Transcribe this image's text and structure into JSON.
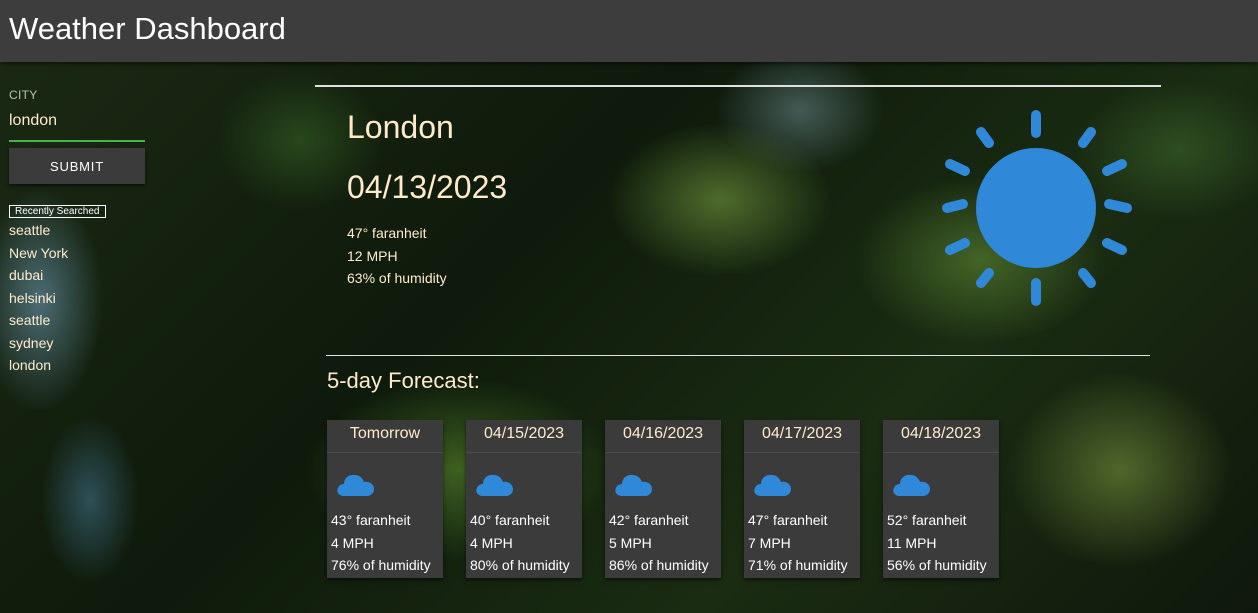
{
  "header": {
    "title": "Weather Dashboard"
  },
  "sidebar": {
    "city_label": "CITY",
    "city_value": "london",
    "submit_label": "SUBMIT",
    "recent_title": "Recently Searched",
    "recent": [
      "seattle",
      "New York",
      "dubai",
      "helsinki",
      "seattle",
      "sydney",
      "london"
    ]
  },
  "current": {
    "city": "London",
    "date": "04/13/2023",
    "temp": "47° faranheit",
    "wind": "12 MPH",
    "humidity": "63% of humidity",
    "icon": "sun-icon"
  },
  "forecast": {
    "title": "5-day Forecast:",
    "days": [
      {
        "label": "Tomorrow",
        "temp": "43° faranheit",
        "wind": "4 MPH",
        "humidity": "76% of humidity",
        "icon": "cloud-icon"
      },
      {
        "label": "04/15/2023",
        "temp": "40° faranheit",
        "wind": "4 MPH",
        "humidity": "80% of humidity",
        "icon": "cloud-icon"
      },
      {
        "label": "04/16/2023",
        "temp": "42° faranheit",
        "wind": "5 MPH",
        "humidity": "86% of humidity",
        "icon": "cloud-icon"
      },
      {
        "label": "04/17/2023",
        "temp": "47° faranheit",
        "wind": "7 MPH",
        "humidity": "71% of humidity",
        "icon": "cloud-icon"
      },
      {
        "label": "04/18/2023",
        "temp": "52° faranheit",
        "wind": "11 MPH",
        "humidity": "56% of humidity",
        "icon": "cloud-icon"
      }
    ]
  },
  "colors": {
    "accent_text": "#ffeacc",
    "icon_blue": "#2f88d8",
    "input_underline": "#4caf50",
    "panel": "#3b3b3b",
    "header": "#3d3d3d"
  }
}
